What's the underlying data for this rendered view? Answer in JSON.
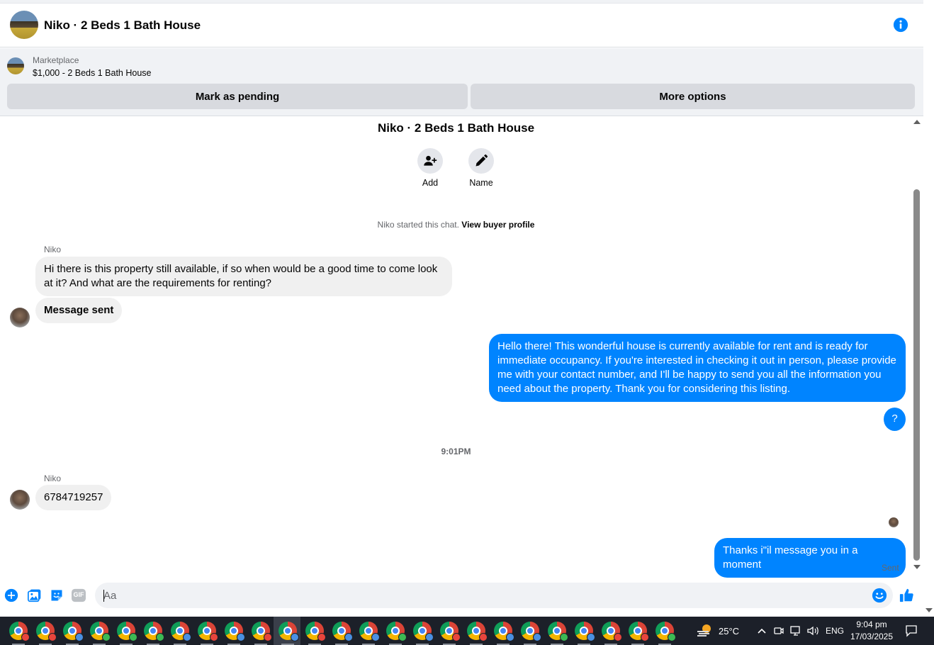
{
  "header": {
    "title": "Niko · 2 Beds 1 Bath House"
  },
  "marketplace": {
    "label": "Marketplace",
    "listing": "$1,000 - 2 Beds 1 Bath House",
    "pending_label": "Mark as pending",
    "more_label": "More options"
  },
  "chat": {
    "title": "Niko · 2 Beds 1 Bath House",
    "actions": [
      {
        "label": "Add",
        "icon": "add-person-icon"
      },
      {
        "label": "Name",
        "icon": "pencil-icon"
      }
    ],
    "started_text": "Niko started this chat.",
    "buyer_profile_link": "View buyer profile",
    "messages": [
      {
        "sender": "Niko",
        "direction": "in",
        "text": "Hi there is this property still available, if so when would be a good time to come look at it? And what are the requirements for renting?"
      },
      {
        "direction": "in",
        "text": "Message sent"
      },
      {
        "direction": "out",
        "text": "Hello there! This wonderful house is currently available for rent and is ready for immediate occupancy. If you're interested in checking it out in person, please provide me with your contact number, and I'll be happy to send you all the information you need about the property. Thank you for considering this listing."
      },
      {
        "direction": "out",
        "text": "?"
      },
      {
        "sender": "Niko",
        "direction": "in",
        "text": "6784719257"
      },
      {
        "direction": "out",
        "text": "Thanks i\"il message you in a moment"
      }
    ],
    "time_separator": "9:01PM",
    "sent_status": "Sent"
  },
  "composer": {
    "placeholder": "Aa",
    "icons": [
      "plus-icon",
      "image-icon",
      "sticker-icon",
      "gif-icon",
      "emoji-icon",
      "like-icon"
    ],
    "gif_label": "GIF"
  },
  "taskbar": {
    "temperature": "25°C",
    "language": "ENG",
    "time": "9:04 pm",
    "date": "17/03/2025"
  },
  "colors": {
    "accent": "#0084ff",
    "incoming_bubble": "#f0f0f0",
    "taskbar": "#1c2029"
  }
}
